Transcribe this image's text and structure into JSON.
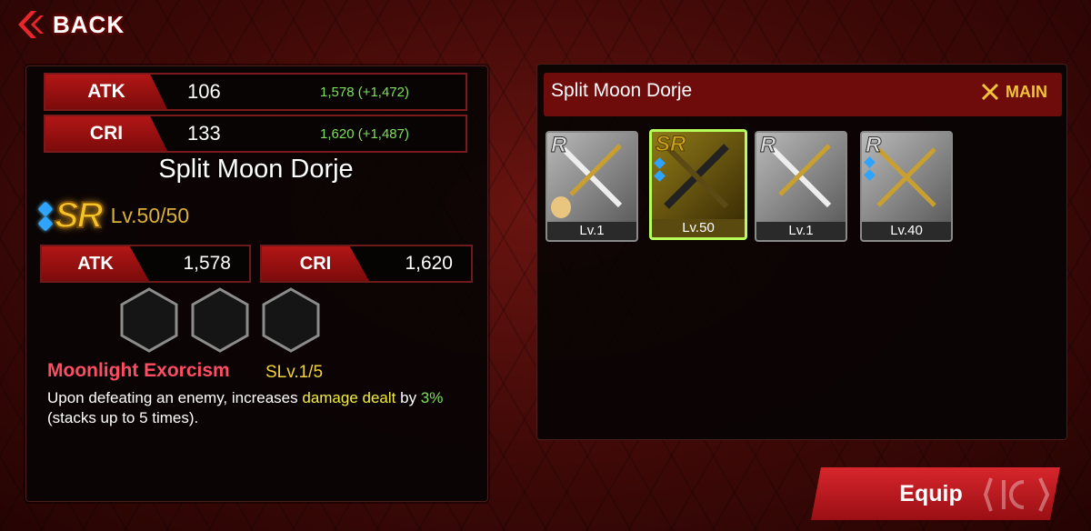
{
  "nav": {
    "back_label": "BACK"
  },
  "current_stats": [
    {
      "name": "ATK",
      "base": "106",
      "total": "1,578 (+1,472)"
    },
    {
      "name": "CRI",
      "base": "133",
      "total": "1,620 (+1,487)"
    }
  ],
  "item": {
    "name": "Split Moon Dorje",
    "rarity": "SR",
    "level": "Lv.50/50",
    "stats": [
      {
        "name": "ATK",
        "value": "1,578"
      },
      {
        "name": "CRI",
        "value": "1,620"
      }
    ],
    "skill": {
      "name": "Moonlight Exorcism",
      "level": "SLv.1/5",
      "desc_1": "Upon defeating an enemy, increases ",
      "desc_hl1": "damage dealt",
      "desc_2": " by ",
      "desc_hl2": "3%",
      "desc_3": " (stacks up to 5 times)."
    }
  },
  "inventory": {
    "title": "Split Moon Dorje",
    "main_label": "MAIN",
    "cards": [
      {
        "rarity": "R",
        "level": "Lv.1"
      },
      {
        "rarity": "SR",
        "level": "Lv.50"
      },
      {
        "rarity": "R",
        "level": "Lv.1"
      },
      {
        "rarity": "R",
        "level": "Lv.40"
      }
    ]
  },
  "actions": {
    "equip_label": "Equip"
  },
  "colors": {
    "accent_red": "#b31616",
    "bonus_green": "#7de05a",
    "gold": "#f3c428",
    "skill_red": "#ff4d63"
  }
}
